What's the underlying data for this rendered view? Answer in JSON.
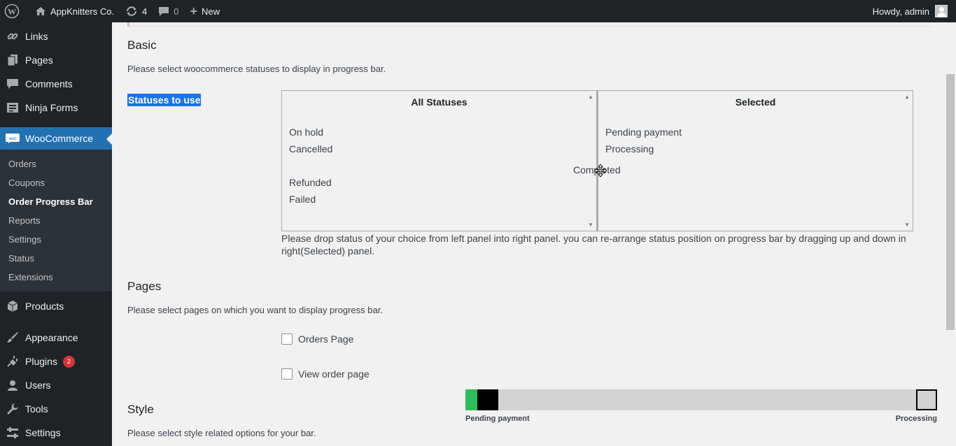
{
  "adminbar": {
    "site_name": "AppKnitters Co.",
    "updates_count": "4",
    "comments_count": "0",
    "new_label": "New",
    "howdy": "Howdy, admin"
  },
  "sidebar": {
    "items_top": [
      {
        "label": "Links",
        "icon": "link-icon"
      },
      {
        "label": "Pages",
        "icon": "pages-icon"
      },
      {
        "label": "Comments",
        "icon": "comment-icon"
      },
      {
        "label": "Ninja Forms",
        "icon": "forms-icon"
      }
    ],
    "woocommerce": {
      "label": "WooCommerce",
      "icon_text": "woo"
    },
    "submenu": [
      "Orders",
      "Coupons",
      "Order Progress Bar",
      "Reports",
      "Settings",
      "Status",
      "Extensions"
    ],
    "items_bottom": [
      {
        "label": "Products",
        "icon": "box-icon"
      },
      {
        "label": "Appearance",
        "icon": "brush-icon"
      },
      {
        "label": "Plugins",
        "icon": "plug-icon",
        "badge": "2"
      },
      {
        "label": "Users",
        "icon": "user-icon"
      },
      {
        "label": "Tools",
        "icon": "wrench-icon"
      },
      {
        "label": "Settings",
        "icon": "settings-icon"
      }
    ]
  },
  "basic": {
    "title": "Basic",
    "description": "Please select woocommerce statuses to display in progress bar.",
    "statuses_label": "Statuses to use",
    "all_statuses": {
      "title": "All Statuses",
      "items": [
        "On hold",
        "Cancelled",
        "Refunded",
        "Failed"
      ]
    },
    "selected": {
      "title": "Selected",
      "items": [
        "Pending payment",
        "Processing"
      ]
    },
    "dragging_item": "Completed",
    "help": "Please drop status of your choice from left panel into right panel. you can re-arrange status position on progress bar by dragging up and down in right(Selected) panel."
  },
  "pages": {
    "title": "Pages",
    "description": "Please select pages on which you want to display progress bar.",
    "options": [
      "Orders Page",
      "View order page"
    ]
  },
  "style": {
    "title": "Style",
    "description": "Please select style related options for your bar."
  },
  "progress_preview": {
    "start_label": "Pending payment",
    "end_label": "Processing",
    "colors": {
      "done": "#2ebd59",
      "current": "#000000",
      "track": "#d3d3d3"
    }
  }
}
